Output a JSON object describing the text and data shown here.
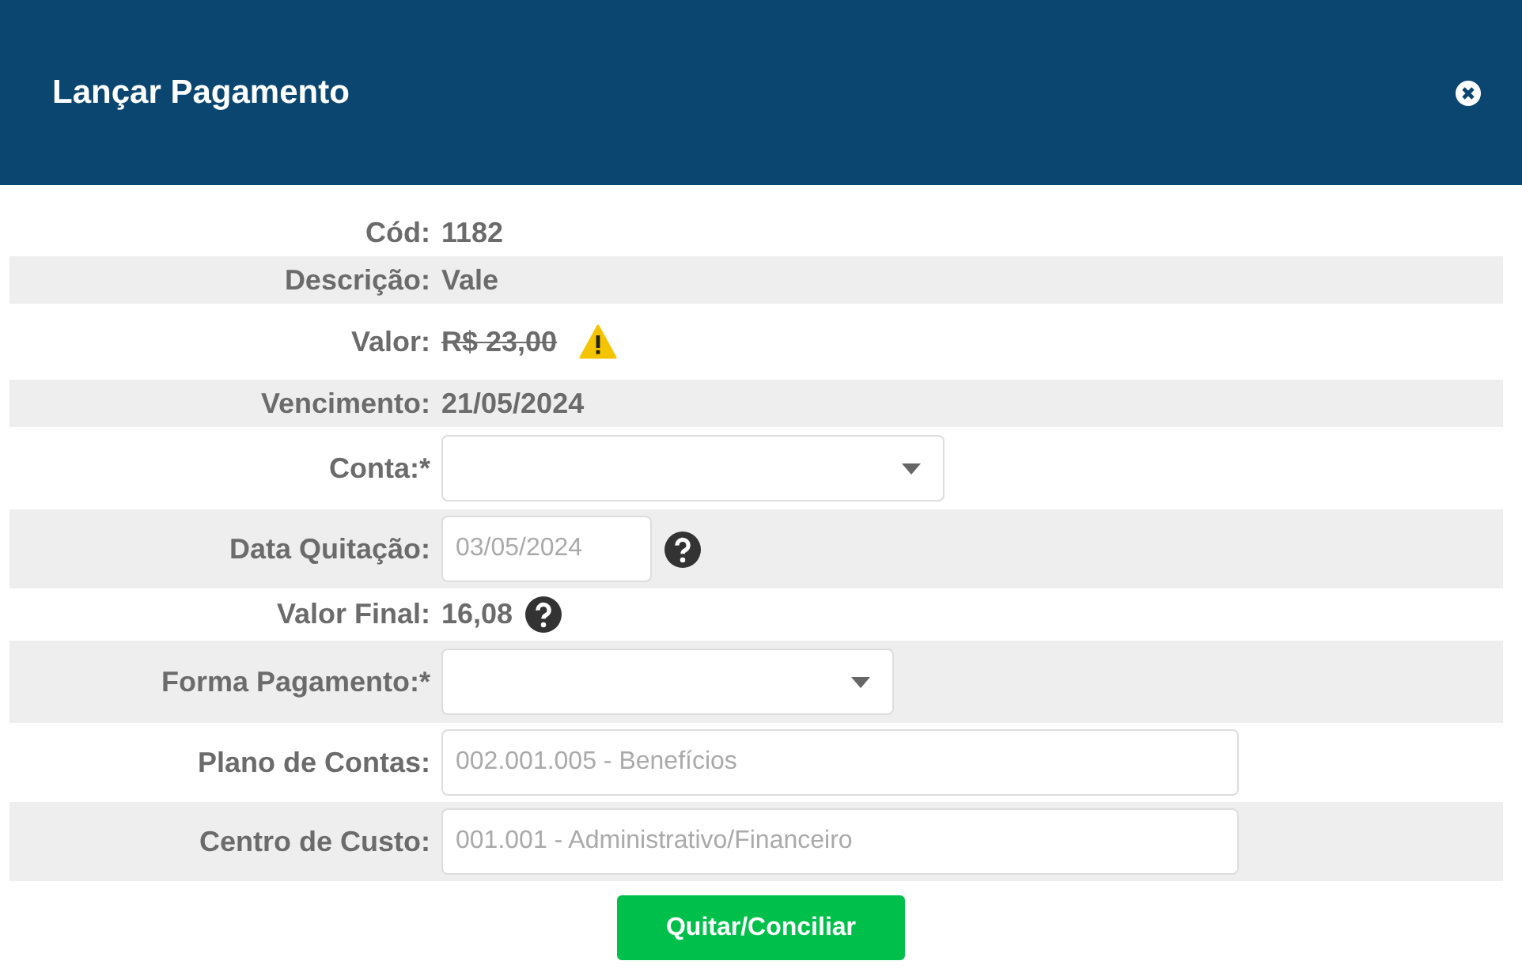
{
  "modal": {
    "title": "Lançar Pagamento"
  },
  "rows": [
    {
      "kind": "text",
      "label": "Cód:",
      "value": "1182"
    },
    {
      "kind": "text",
      "label": "Descrição:",
      "value": "Vale"
    },
    {
      "kind": "text",
      "label": "Valor:",
      "value": "R$ 23,00",
      "struck": true,
      "warning": true
    },
    {
      "kind": "text",
      "label": "Vencimento:",
      "value": "21/05/2024"
    },
    {
      "kind": "select",
      "label": "Conta:*"
    },
    {
      "kind": "input",
      "label": "Data Quitação:",
      "placeholder": "03/05/2024",
      "help": true
    },
    {
      "kind": "text",
      "label": "Valor Final:",
      "value": "16,08",
      "help": true
    },
    {
      "kind": "select",
      "label": "Forma Pagamento:*"
    },
    {
      "kind": "input",
      "label": "Plano de Contas:",
      "placeholder": "002.001.005 - Benefícios"
    },
    {
      "kind": "input",
      "label": "Centro de Custo:",
      "placeholder": "001.001 - Administrativo/Financeiro"
    }
  ],
  "submit_button": "Quitar/Conciliar"
}
